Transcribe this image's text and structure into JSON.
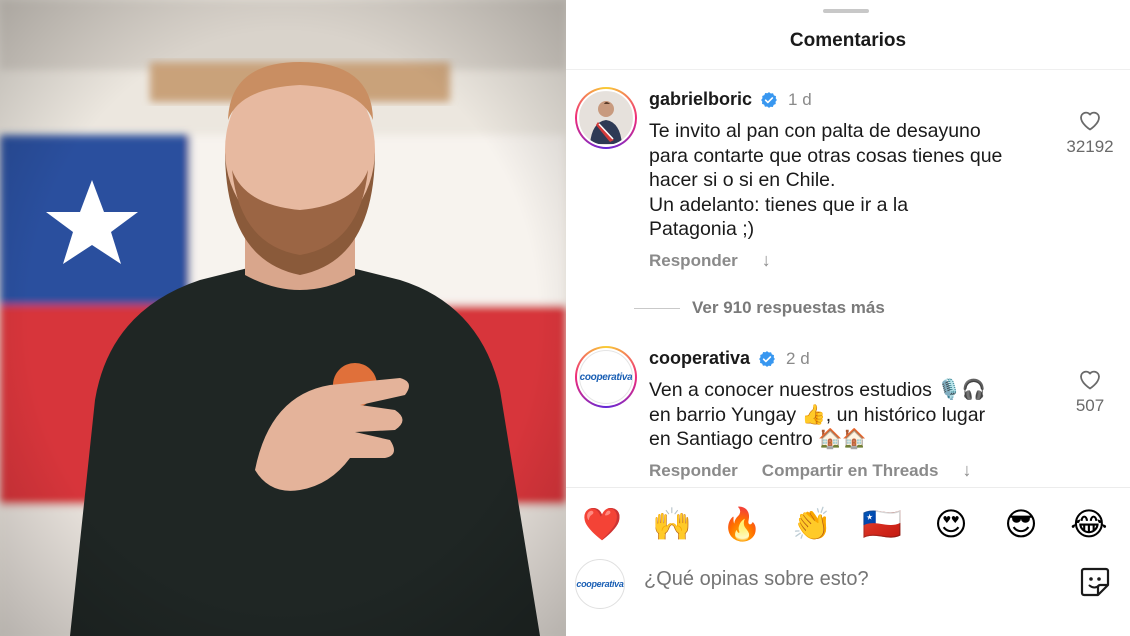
{
  "sheet": {
    "title": "Comentarios"
  },
  "comments": [
    {
      "username": "gabrielboric",
      "time": "1 d",
      "text": "Te invito al pan con palta de desayuno\npara contarte que otras cosas tienes que\nhacer si o si en Chile.\nUn adelanto: tienes que ir a la\nPatagonia ;)",
      "reply_label": "Responder",
      "likes": "32192"
    },
    {
      "username": "cooperativa",
      "time": "2 d",
      "text": "Ven a conocer nuestros estudios 🎙️🎧\nen barrio Yungay 👍, un histórico lugar\nen Santiago centro 🏠🏠",
      "reply_label": "Responder",
      "share_label": "Compartir en Threads",
      "likes": "507",
      "avatar_text": "cooperativa"
    }
  ],
  "more_replies": "Ver 910 respuestas más",
  "emoji_bar": [
    "❤️",
    "🙌",
    "🔥",
    "👏",
    "🇨🇱",
    "😍",
    "😎",
    "😂"
  ],
  "composer": {
    "placeholder": "¿Qué opinas sobre esto?",
    "avatar_text": "cooperativa"
  },
  "icons": {
    "like": "heart-outline-icon",
    "verified": "verified-badge-icon",
    "sticker": "sticker-icon",
    "expand": "down-arrow-icon"
  },
  "colors": {
    "verified": "#3897f0",
    "text": "#1a1a1a",
    "muted": "#8a8a8a",
    "coop_brand": "#1a5fb4"
  }
}
